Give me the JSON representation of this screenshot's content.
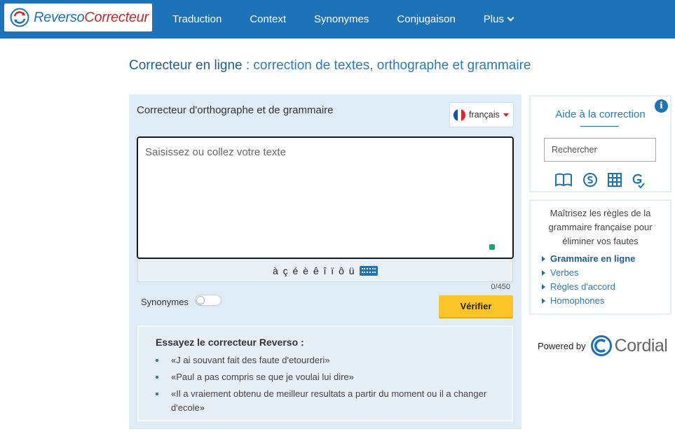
{
  "header": {
    "logo_part1": "Reverso",
    "logo_part2": "Correcteur",
    "nav": [
      {
        "label": "Traduction"
      },
      {
        "label": "Context"
      },
      {
        "label": "Synonymes"
      },
      {
        "label": "Conjugaison"
      },
      {
        "label": "Plus"
      }
    ]
  },
  "page": {
    "title_main": "Correcteur en ligne",
    "title_sub": " : correction de textes, orthographe et grammaire"
  },
  "editor": {
    "heading": "Correcteur d'orthographe et de grammaire",
    "language": "français",
    "placeholder": "Saisissez ou collez votre texte",
    "special_chars": "à ç é è ê î ï ô ü",
    "counter": "0/450",
    "synonyms_label": "Synonymes",
    "verify_label": "Vérifier"
  },
  "examples": {
    "title": "Essayez le correcteur Reverso :",
    "items": [
      "«J ai souvant fait des faute d'etourderi»",
      "«Paul a pas compris se que je voulai lui dire»",
      "«Il a vraiement obtenu de meilleur resultats a partir du moment ou il a changer d'ecole»"
    ]
  },
  "sidebar": {
    "info": "i",
    "help_title": "Aide à la correction",
    "search_placeholder": "Rechercher",
    "tools": [
      "book-icon",
      "synonym-icon",
      "grid-icon",
      "conjugation-icon"
    ],
    "description": "Maîtrisez les règles de la grammaire française pour éliminer vos fautes",
    "links": [
      "Grammaire en ligne",
      "Verbes",
      "Règles d'accord",
      "Homophones"
    ],
    "powered_by": "Powered by",
    "powered_brand": "Cordial"
  },
  "colors": {
    "brand_blue": "#1e73b8",
    "brand_red": "#c62b2b",
    "verify_yellow": "#fbc52a",
    "panel_bg": "#dfecf5"
  }
}
